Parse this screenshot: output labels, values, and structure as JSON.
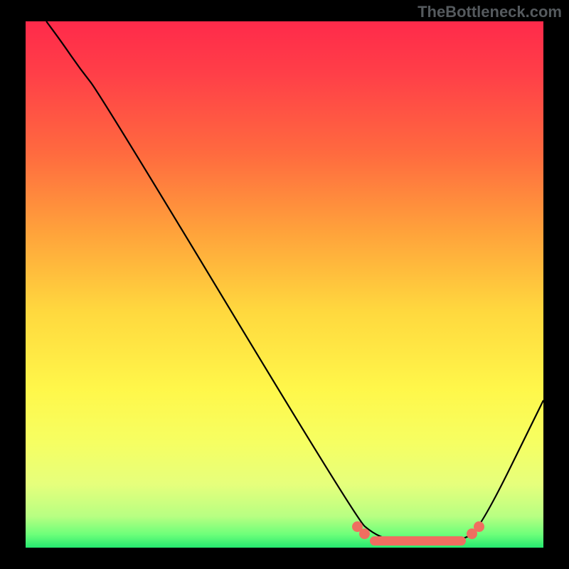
{
  "watermark": "TheBottleneck.com",
  "colors": {
    "frame_bg": "#000000",
    "curve_stroke": "#000000",
    "marker_fill": "#ef6e60",
    "watermark_text": "#555a5e"
  },
  "chart_data": {
    "type": "line",
    "title": "",
    "xlabel": "",
    "ylabel": "",
    "xlim": [
      0,
      100
    ],
    "ylim": [
      0,
      100
    ],
    "background_gradient_stops": [
      {
        "pos": 0.0,
        "color": "#ff2a4a"
      },
      {
        "pos": 0.1,
        "color": "#ff3f48"
      },
      {
        "pos": 0.25,
        "color": "#ff6a3f"
      },
      {
        "pos": 0.4,
        "color": "#ffa23b"
      },
      {
        "pos": 0.55,
        "color": "#ffd83e"
      },
      {
        "pos": 0.7,
        "color": "#fff74a"
      },
      {
        "pos": 0.8,
        "color": "#f6ff62"
      },
      {
        "pos": 0.88,
        "color": "#e6ff7c"
      },
      {
        "pos": 0.94,
        "color": "#b8ff82"
      },
      {
        "pos": 0.975,
        "color": "#6dff7a"
      },
      {
        "pos": 1.0,
        "color": "#25e86f"
      }
    ],
    "series": [
      {
        "name": "bottleneck-curve",
        "x": [
          4.0,
          7.0,
          10.5,
          14.5,
          64.0,
          67.0,
          70.0,
          74.0,
          80.0,
          84.0,
          87.5,
          100.0
        ],
        "y": [
          100.0,
          96.0,
          91.0,
          86.0,
          5.3,
          2.8,
          1.5,
          0.8,
          0.8,
          1.5,
          3.0,
          28.0
        ]
      }
    ],
    "flat_region_markers": {
      "x_start": 64.0,
      "x_end": 87.5,
      "y": 1.3,
      "note": "visual salmon markers near curve minimum"
    }
  }
}
